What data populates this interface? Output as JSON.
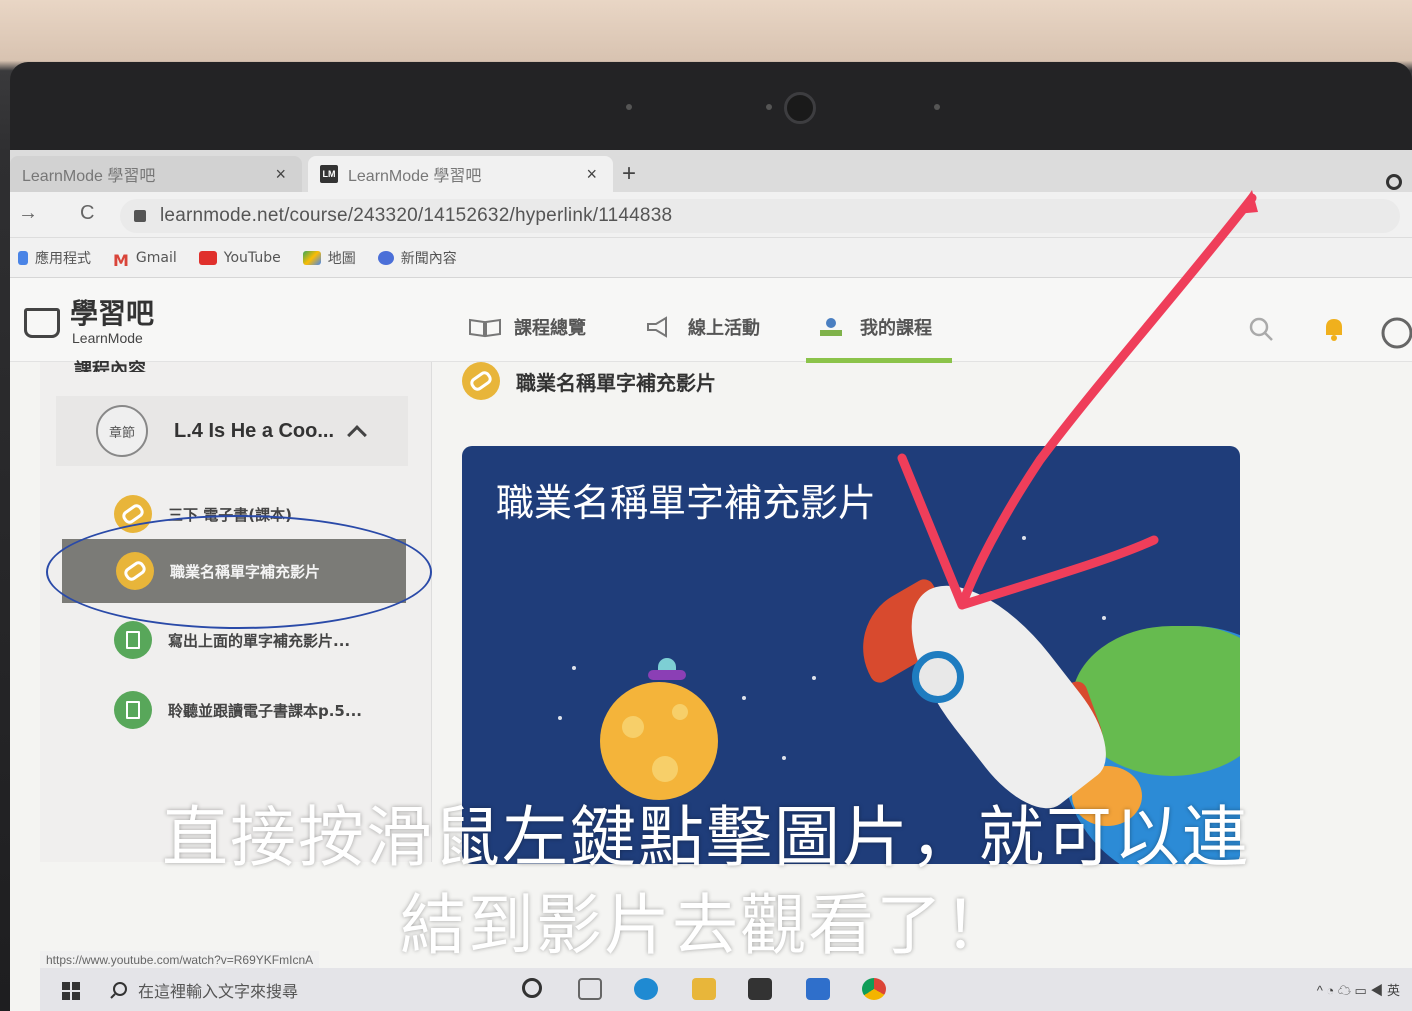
{
  "browser": {
    "tabs": [
      {
        "label": "LearnMode 學習吧",
        "active": false
      },
      {
        "label": "LearnMode 學習吧",
        "active": true
      }
    ],
    "close_symbol": "×",
    "new_tab_symbol": "+",
    "nav": {
      "back": "←",
      "forward": "→",
      "reload": "C"
    },
    "url": "learnmode.net/course/243320/14152632/hyperlink/1144838",
    "bookmarks": [
      "應用程式",
      "Gmail",
      "YouTube",
      "地圖",
      "新聞內容"
    ]
  },
  "site": {
    "logo_title": "學習吧",
    "logo_sub": "LearnMode",
    "nav": [
      "課程總覽",
      "線上活動",
      "我的課程"
    ],
    "active_nav": "我的課程",
    "accent_color": "#8bc34a"
  },
  "sidebar": {
    "title": "課程內容",
    "chapter_badge": "章節",
    "chapter_label": "L.4 Is He a Coo...",
    "items": [
      {
        "label": "三下 電子書(課本)",
        "icon": "link-icon",
        "selected": false
      },
      {
        "label": "職業名稱單字補充影片",
        "icon": "link-icon",
        "selected": true
      },
      {
        "label": "寫出上面的單字補充影片...",
        "icon": "document-icon",
        "selected": false
      },
      {
        "label": "聆聽並跟讀電子書課本p.5...",
        "icon": "document-icon",
        "selected": false
      }
    ]
  },
  "main": {
    "heading": "職業名稱單字補充影片",
    "video_title": "職業名稱單字補充影片"
  },
  "annotation": {
    "caption_line1": "直接按滑鼠左鍵點擊圖片，就可以連",
    "caption_line2": "結到影片去觀看了！",
    "arrow_color": "#ef3e5a",
    "ellipse_color": "#2a4aa8"
  },
  "status_url": "https://www.youtube.com/watch?v=R69YKFmIcnA",
  "taskbar": {
    "search_placeholder": "在這裡輸入文字來搜尋"
  }
}
